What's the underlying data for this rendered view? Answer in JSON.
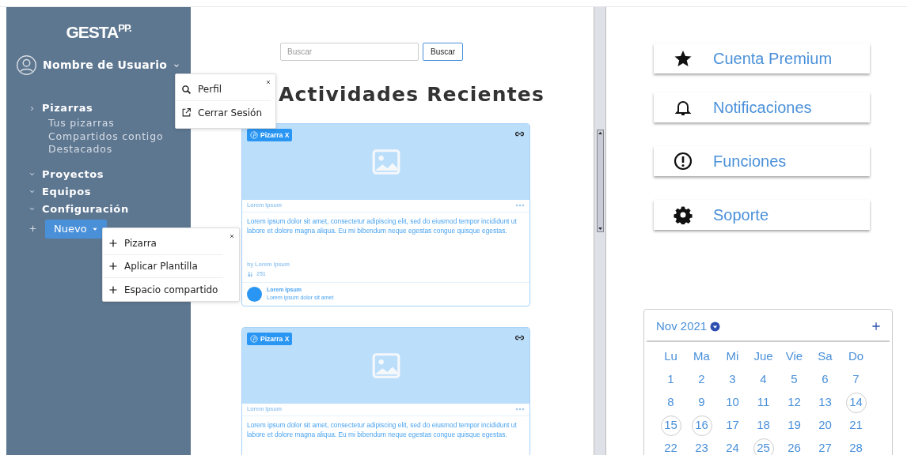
{
  "sidebar": {
    "logo": "GESTA$^{PP.}$",
    "user": {
      "name": "Nombre de Usuario"
    },
    "nav": [
      {
        "label": "Pizarras",
        "expanded": true,
        "children": [
          {
            "label": "Tus pizarras"
          },
          {
            "label": "Compartidos contigo"
          },
          {
            "label": "Destacados"
          }
        ]
      },
      {
        "label": "Proyectos",
        "expanded": false
      },
      {
        "label": "Equipos",
        "expanded": false
      },
      {
        "label": "Configuración",
        "expanded": false
      }
    ],
    "new_button": "Nuevo"
  },
  "user_menu": {
    "items": [
      {
        "label": "Perfil",
        "kind": "search"
      },
      {
        "label": "Cerrar Sesión",
        "kind": "external"
      }
    ]
  },
  "new_menu": {
    "items": [
      {
        "label": "Pizarra"
      },
      {
        "label": "Aplicar Plantilla"
      },
      {
        "label": "Espacio compartido"
      }
    ]
  },
  "search": {
    "placeholder": "Buscar",
    "button": "Buscar"
  },
  "heading": "Actividades Recientes",
  "cards": [
    {
      "tag": "Pizarra X",
      "label": "Lorem Ipsum",
      "text": "Lorem ipsum dolor sit amet, consectetur adipiscing elit, sed do eiusmod tempor incididunt ut labore et dolore magna aliqua. Eu mi bibendum neque egestas congue quisque egestas.",
      "author": "by Lorem Ipsum",
      "count": "251",
      "footer_title": "Lorem Ipsum",
      "footer_text": "Lorem ipsum dolor sit amet"
    },
    {
      "tag": "Pizarra X",
      "label": "Lorem Ipsum",
      "text": "Lorem ipsum dolor sit amet, consectetur adipiscing elit, sed do eiusmod tempor incididunt ut labore et dolore magna aliqua. Eu mi bibendum neque egestas congue quisque egestas."
    }
  ],
  "actions": [
    {
      "label": "Cuenta Premium",
      "kind": "star"
    },
    {
      "label": "Notificaciones",
      "kind": "bell"
    },
    {
      "label": "Funciones",
      "kind": "alert"
    },
    {
      "label": "Soporte",
      "kind": "gear"
    }
  ],
  "calendar": {
    "month": "Nov 2021",
    "weekdays": [
      "Lu",
      "Ma",
      "Mi",
      "Jue",
      "Vie",
      "Sa",
      "Do"
    ],
    "days": [
      {
        "day": "1",
        "marked": false
      },
      {
        "day": "2",
        "marked": false
      },
      {
        "day": "3",
        "marked": false
      },
      {
        "day": "4",
        "marked": false
      },
      {
        "day": "5",
        "marked": false
      },
      {
        "day": "6",
        "marked": false
      },
      {
        "day": "7",
        "marked": false
      },
      {
        "day": "8",
        "marked": false
      },
      {
        "day": "9",
        "marked": false
      },
      {
        "day": "10",
        "marked": false
      },
      {
        "day": "11",
        "marked": false
      },
      {
        "day": "12",
        "marked": false
      },
      {
        "day": "13",
        "marked": false
      },
      {
        "day": "14",
        "marked": true
      },
      {
        "day": "15",
        "marked": true
      },
      {
        "day": "16",
        "marked": true
      },
      {
        "day": "17",
        "marked": false
      },
      {
        "day": "18",
        "marked": false
      },
      {
        "day": "19",
        "marked": false
      },
      {
        "day": "20",
        "marked": false
      },
      {
        "day": "21",
        "marked": false
      },
      {
        "day": "22",
        "marked": false
      },
      {
        "day": "23",
        "marked": false
      },
      {
        "day": "24",
        "marked": false
      },
      {
        "day": "25",
        "marked": true
      },
      {
        "day": "26",
        "marked": false
      },
      {
        "day": "27",
        "marked": false
      },
      {
        "day": "28",
        "marked": false
      }
    ]
  }
}
